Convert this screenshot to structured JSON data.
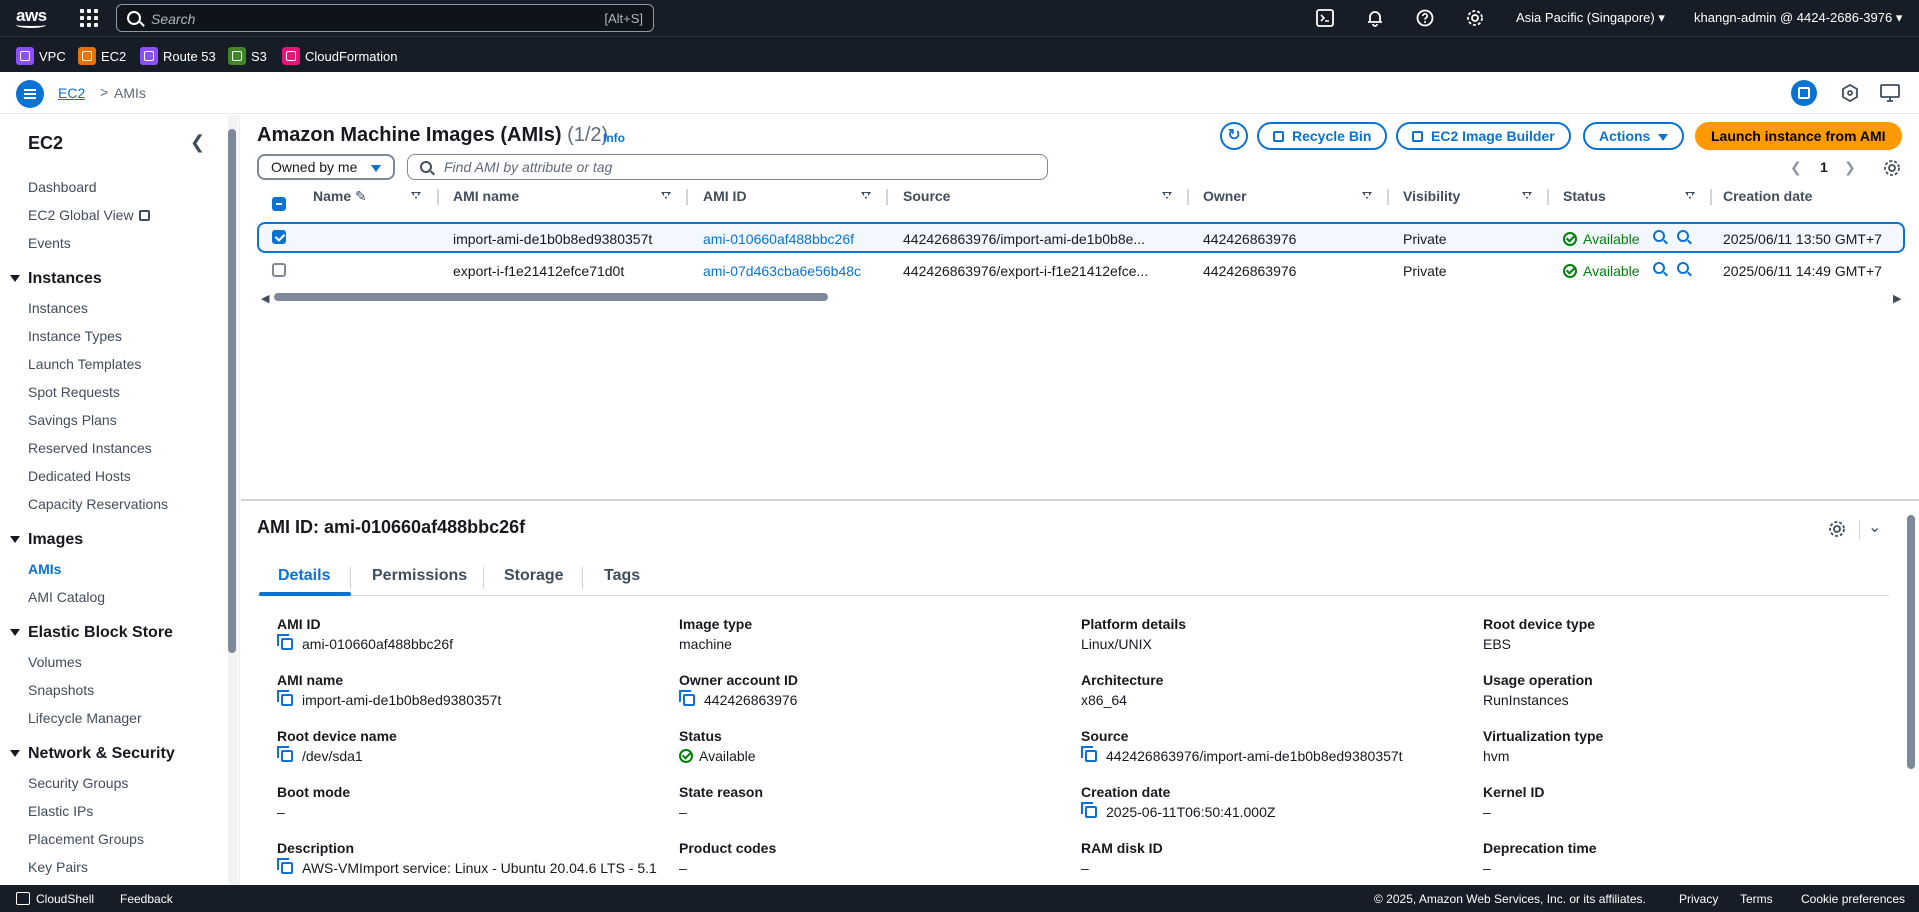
{
  "topnav": {
    "logo": "aws",
    "search_placeholder": "Search",
    "search_shortcut": "[Alt+S]",
    "region": "Asia Pacific (Singapore)",
    "account": "khangn-admin @ 4424-2686-3976"
  },
  "favorites": [
    {
      "label": "VPC",
      "color": "#8c4fff"
    },
    {
      "label": "EC2",
      "color": "#ed7100"
    },
    {
      "label": "Route 53",
      "color": "#8c4fff"
    },
    {
      "label": "S3",
      "color": "#3f8624"
    },
    {
      "label": "CloudFormation",
      "color": "#e7157b"
    }
  ],
  "breadcrumb": {
    "root": "EC2",
    "sep": ">",
    "current": "AMIs"
  },
  "sidebar": {
    "title": "EC2",
    "top_items": [
      "Dashboard",
      "EC2 Global View",
      "Events"
    ],
    "sections": [
      {
        "title": "Instances",
        "items": [
          "Instances",
          "Instance Types",
          "Launch Templates",
          "Spot Requests",
          "Savings Plans",
          "Reserved Instances",
          "Dedicated Hosts",
          "Capacity Reservations"
        ]
      },
      {
        "title": "Images",
        "items": [
          "AMIs",
          "AMI Catalog"
        ]
      },
      {
        "title": "Elastic Block Store",
        "items": [
          "Volumes",
          "Snapshots",
          "Lifecycle Manager"
        ]
      },
      {
        "title": "Network & Security",
        "items": [
          "Security Groups",
          "Elastic IPs",
          "Placement Groups",
          "Key Pairs"
        ]
      }
    ],
    "active_item": "AMIs"
  },
  "main": {
    "title": "Amazon Machine Images (AMIs)",
    "count": "(1/2)",
    "info": "Info",
    "buttons": {
      "recycle": "Recycle Bin",
      "builder": "EC2 Image Builder",
      "actions": "Actions",
      "launch": "Launch instance from AMI"
    },
    "owner_filter": "Owned by me",
    "filter_placeholder": "Find AMI by attribute or tag",
    "page": "1",
    "columns": [
      "Name",
      "AMI name",
      "AMI ID",
      "Source",
      "Owner",
      "Visibility",
      "Status",
      "Creation date"
    ],
    "rows": [
      {
        "selected": true,
        "name": "",
        "ami_name": "import-ami-de1b0b8ed9380357t",
        "ami_id": "ami-010660af488bbc26f",
        "source": "442426863976/import-ami-de1b0b8e...",
        "owner": "442426863976",
        "visibility": "Private",
        "status": "Available",
        "created": "2025/06/11 13:50 GMT+7"
      },
      {
        "selected": false,
        "name": "",
        "ami_name": "export-i-f1e21412efce71d0t",
        "ami_id": "ami-07d463cba6e56b48c",
        "source": "442426863976/export-i-f1e21412efce...",
        "owner": "442426863976",
        "visibility": "Private",
        "status": "Available",
        "created": "2025/06/11 14:49 GMT+7"
      }
    ]
  },
  "details": {
    "title": "AMI ID: ami-010660af488bbc26f",
    "tabs": [
      "Details",
      "Permissions",
      "Storage",
      "Tags"
    ],
    "fields": [
      {
        "k": "AMI ID",
        "v": "ami-010660af488bbc26f"
      },
      {
        "k": "Image type",
        "v": "machine"
      },
      {
        "k": "Platform details",
        "v": "Linux/UNIX"
      },
      {
        "k": "Root device type",
        "v": "EBS"
      },
      {
        "k": "AMI name",
        "v": "import-ami-de1b0b8ed9380357t"
      },
      {
        "k": "Owner account ID",
        "v": "442426863976"
      },
      {
        "k": "Architecture",
        "v": "x86_64"
      },
      {
        "k": "Usage operation",
        "v": "RunInstances"
      },
      {
        "k": "Root device name",
        "v": "/dev/sda1"
      },
      {
        "k": "Status",
        "v": "Available"
      },
      {
        "k": "Source",
        "v": "442426863976/import-ami-de1b0b8ed9380357t"
      },
      {
        "k": "Virtualization type",
        "v": "hvm"
      },
      {
        "k": "Boot mode",
        "v": "–"
      },
      {
        "k": "State reason",
        "v": "–"
      },
      {
        "k": "Creation date",
        "v": "2025-06-11T06:50:41.000Z"
      },
      {
        "k": "Kernel ID",
        "v": "–"
      },
      {
        "k": "Description",
        "v": "AWS-VMImport service: Linux - Ubuntu 20.04.6 LTS - 5.1"
      },
      {
        "k": "Product codes",
        "v": "–"
      },
      {
        "k": "RAM disk ID",
        "v": "–"
      },
      {
        "k": "Deprecation time",
        "v": "–"
      }
    ]
  },
  "footer": {
    "cloudshell": "CloudShell",
    "feedback": "Feedback",
    "copyright": "© 2025, Amazon Web Services, Inc. or its affiliates.",
    "privacy": "Privacy",
    "terms": "Terms",
    "cookies": "Cookie preferences"
  }
}
